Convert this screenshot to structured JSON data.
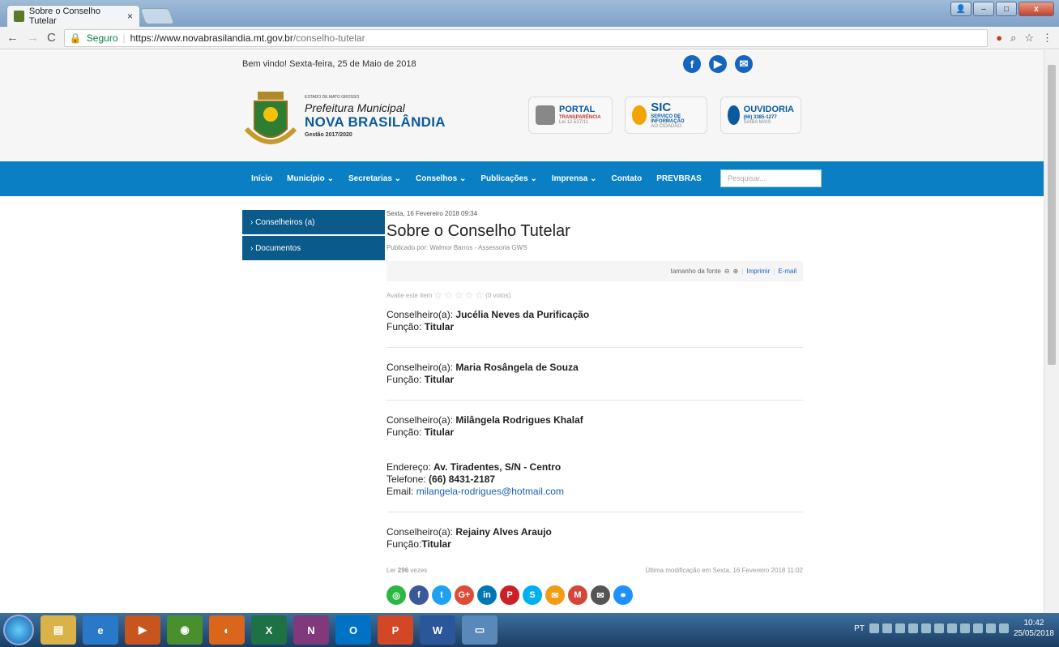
{
  "browser": {
    "tab_title": "Sobre o Conselho Tutelar",
    "tab_close": "×",
    "url_secure_label": "Seguro",
    "url_host": "https://www.novabrasilandia.mt.gov.br",
    "url_path": "/conselho-tutelar"
  },
  "topbar": {
    "welcome": "Bem vindo! Sexta-feira, 25 de Maio de 2018"
  },
  "header": {
    "state_label": "ESTADO DE MATO GROSSO",
    "org": "Prefeitura Municipal",
    "city": "NOVA BRASILÂNDIA",
    "term": "Gestão 2017/2020",
    "badges": [
      {
        "title": "PORTAL",
        "sub": "TRANSPARÊNCIA",
        "foot": "Lei 12.527/11",
        "color": "#c0392b"
      },
      {
        "title": "SIC",
        "sub": "SERVIÇO DE INFORMAÇÃO",
        "foot": "AO CIDADÃO",
        "color": "#f0a500"
      },
      {
        "title": "OUVIDORIA",
        "sub": "(66) 3385-1277",
        "foot": "SAIBA MAIS",
        "color": "#0a5a9c"
      }
    ]
  },
  "nav": {
    "items": [
      "Início",
      "Município ⌄",
      "Secretarias ⌄",
      "Conselhos ⌄",
      "Publicações ⌄",
      "Imprensa ⌄",
      "Contato",
      "PREVBRAS"
    ],
    "search_placeholder": "Pesquisar..."
  },
  "sidebar": {
    "items": [
      "› Conselheiros (a)",
      "› Documentos"
    ]
  },
  "article": {
    "date": "Sexta, 16 Fevereiro 2018 09:34",
    "title": "Sobre o Conselho Tutelar",
    "byline": "Publicado por: Walmor Barros - Assessoria GWS",
    "font_size_label": "tamanho da fonte",
    "print": "Imprimir",
    "email": "E-mail",
    "rate_label": "Avalie este item",
    "rate_votes": "(0 votos)",
    "c1_label": "Conselheiro(a):",
    "c1_name": "Jucélia Neves da Purificação",
    "f_label": "Função:",
    "f_value": "Titular",
    "c2_name": "Maria Rosângela de Souza",
    "c3_name": "Milângela Rodrigues Khalaf",
    "addr_label": "Endereço:",
    "addr": "Av. Tiradentes, S/N - Centro",
    "phone_label": "Telefone:",
    "phone": "(66) 8431-2187",
    "mail_label": "Email:",
    "mail": "milangela-rodrigues@hotmail.com",
    "c4_name": "Rejainy Alves Araujo",
    "f_label_tight": "Função:",
    "reads_prefix": "Ler",
    "reads": "296",
    "reads_suffix": "vezes",
    "modified": "Última modificação em Sexta, 16 Fevereiro 2018 11:02"
  },
  "share": [
    {
      "icon": "whatsapp-icon",
      "glyph": "◎",
      "color": "#2bb741"
    },
    {
      "icon": "facebook-icon",
      "glyph": "f",
      "color": "#3b5998"
    },
    {
      "icon": "twitter-icon",
      "glyph": "t",
      "color": "#1da1f2"
    },
    {
      "icon": "googleplus-icon",
      "glyph": "G+",
      "color": "#dd4b39"
    },
    {
      "icon": "linkedin-icon",
      "glyph": "in",
      "color": "#0077b5"
    },
    {
      "icon": "pinterest-icon",
      "glyph": "P",
      "color": "#cb2027"
    },
    {
      "icon": "skype-icon",
      "glyph": "S",
      "color": "#00aff0"
    },
    {
      "icon": "email-icon",
      "glyph": "✉",
      "color": "#f39c12"
    },
    {
      "icon": "gmail-icon",
      "glyph": "M",
      "color": "#d44638"
    },
    {
      "icon": "mail-icon",
      "glyph": "✉",
      "color": "#555555"
    },
    {
      "icon": "link-icon",
      "glyph": "⚭",
      "color": "#1e90ff"
    }
  ],
  "taskbar": {
    "lang": "PT",
    "time": "10:42",
    "date": "25/05/2018"
  }
}
